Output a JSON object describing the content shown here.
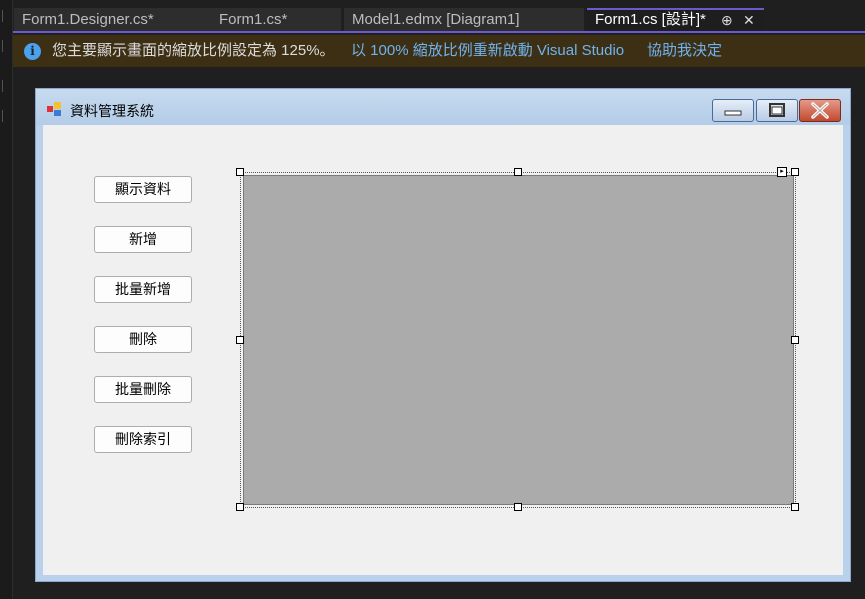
{
  "tabs": [
    {
      "label": "Form1.Designer.cs*"
    },
    {
      "label": "Form1.cs*"
    },
    {
      "label": "Model1.edmx [Diagram1]"
    },
    {
      "label": "Form1.cs [設計]*"
    }
  ],
  "tab_controls": {
    "pin": "⊕",
    "close": "✕"
  },
  "infobar": {
    "message": "您主要顯示畫面的縮放比例設定為 125%。",
    "restart_link": "以 100% 縮放比例重新啟動 Visual Studio",
    "help_link": "協助我決定"
  },
  "form": {
    "title": "資料管理系統",
    "buttons": [
      {
        "label": "顯示資料"
      },
      {
        "label": "新增"
      },
      {
        "label": "批量新增"
      },
      {
        "label": "刪除"
      },
      {
        "label": "批量刪除"
      },
      {
        "label": "刪除索引"
      }
    ]
  },
  "colors": {
    "accent": "#6a5acd",
    "info_bg": "#3d2f13",
    "link": "#6fb3f0",
    "grid_bg": "#ababab"
  }
}
